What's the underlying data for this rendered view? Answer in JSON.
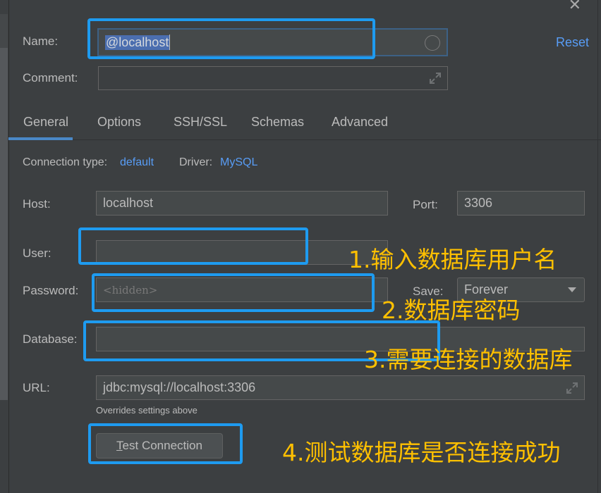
{
  "dialog": {
    "close_icon": "close-icon",
    "name_label": "Name:",
    "name_value": "@localhost",
    "comment_label": "Comment:",
    "comment_value": "",
    "reset_label": "Reset"
  },
  "tabs": [
    {
      "label": "General",
      "active": true
    },
    {
      "label": "Options",
      "active": false
    },
    {
      "label": "SSH/SSL",
      "active": false
    },
    {
      "label": "Schemas",
      "active": false
    },
    {
      "label": "Advanced",
      "active": false
    }
  ],
  "general": {
    "connection_type_label": "Connection type:",
    "connection_type_value": "default",
    "driver_label": "Driver:",
    "driver_value": "MySQL",
    "host_label": "Host:",
    "host_value": "localhost",
    "port_label": "Port:",
    "port_value": "3306",
    "user_label": "User:",
    "user_value": "",
    "password_label": "Password:",
    "password_placeholder": "<hidden>",
    "save_label": "Save:",
    "save_value": "Forever",
    "database_label": "Database:",
    "database_value": "",
    "url_label": "URL:",
    "url_value": "jdbc:mysql://localhost:3306",
    "url_hint": "Overrides settings above",
    "test_connection_label": "Test Connection"
  },
  "annotations": [
    "1.输入数据库用户名",
    "2.数据库密码",
    "3.需要连接的数据库",
    "4.测试数据库是否连接成功"
  ],
  "colors": {
    "background": "#3c3f41",
    "field_bg": "#45494a",
    "accent": "#589df6",
    "annotation_box": "#1e9bf0",
    "annotation_text": "#ffc000"
  }
}
